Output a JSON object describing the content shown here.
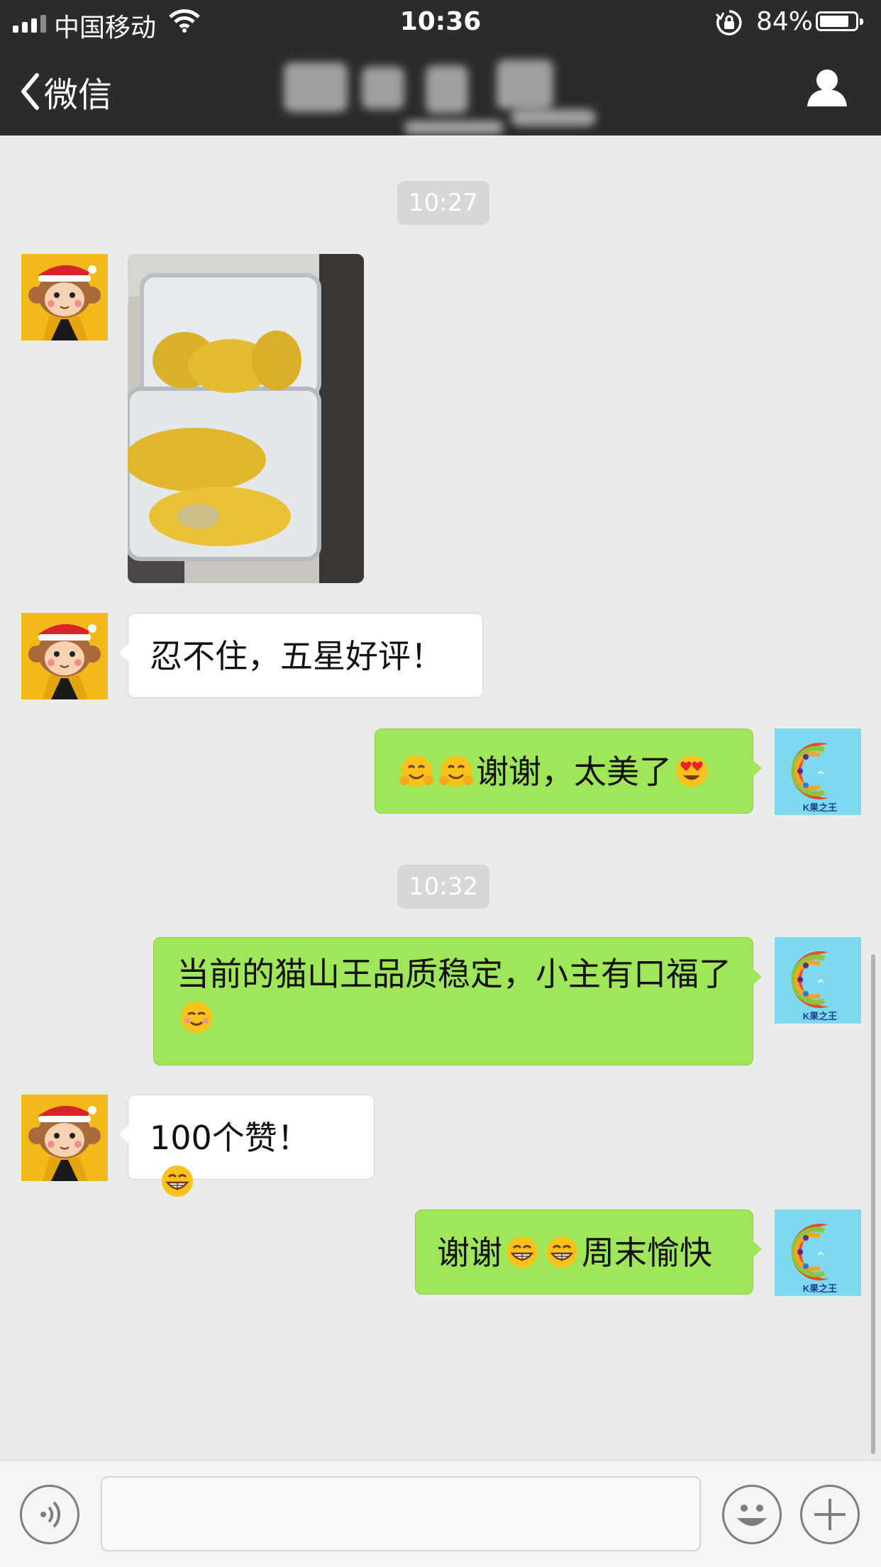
{
  "status_bar": {
    "carrier": "中国移动",
    "time": "10:36",
    "battery": "84%",
    "battery_level": 0.84
  },
  "nav": {
    "back_label": "微信",
    "title": ""
  },
  "messages": {
    "t1": "10:27",
    "m2": "忍不住，五星好评！",
    "m3": "谢谢，太美了",
    "t2": "10:32",
    "m4": "当前的猫山王品质稳定，小主有口福了",
    "m5": "100个赞！",
    "m6a": "谢谢",
    "m6b": "周末愉快"
  },
  "avatars": {
    "shop_logo_text": "K果之王"
  },
  "input": {
    "placeholder": ""
  },
  "colors": {
    "nav_bg": "#2b2b2d",
    "chat_bg": "#ebebeb",
    "out_bubble": "#9fe658",
    "in_bubble": "#ffffff"
  }
}
